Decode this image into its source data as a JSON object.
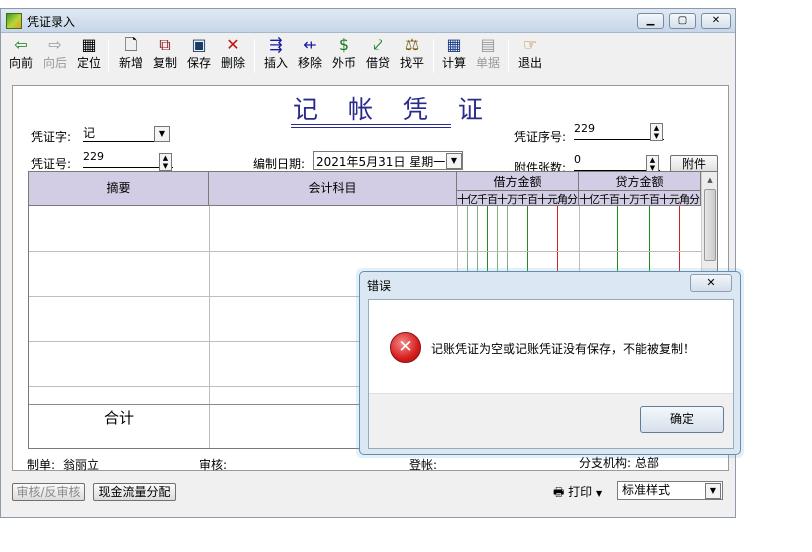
{
  "window": {
    "title": "凭证录入"
  },
  "toolbar": {
    "items": [
      {
        "label": "向前",
        "icon": "back-arrow-icon",
        "enabled": true
      },
      {
        "label": "向后",
        "icon": "forward-arrow-icon",
        "enabled": false
      },
      {
        "label": "定位",
        "icon": "locate-icon",
        "enabled": true
      },
      {
        "label": "新增",
        "icon": "new-document-icon",
        "enabled": true
      },
      {
        "label": "复制",
        "icon": "copy-icon",
        "enabled": true
      },
      {
        "label": "保存",
        "icon": "save-icon",
        "enabled": true
      },
      {
        "label": "删除",
        "icon": "delete-icon",
        "enabled": true
      },
      {
        "label": "插入",
        "icon": "insert-row-icon",
        "enabled": true
      },
      {
        "label": "移除",
        "icon": "remove-row-icon",
        "enabled": true
      },
      {
        "label": "外币",
        "icon": "foreign-currency-icon",
        "enabled": true
      },
      {
        "label": "借贷",
        "icon": "debit-credit-icon",
        "enabled": true
      },
      {
        "label": "找平",
        "icon": "balance-icon",
        "enabled": true
      },
      {
        "label": "计算",
        "icon": "calculator-icon",
        "enabled": true
      },
      {
        "label": "单据",
        "icon": "document-list-icon",
        "enabled": false
      },
      {
        "label": "退出",
        "icon": "exit-icon",
        "enabled": true
      }
    ]
  },
  "voucher": {
    "title": "记 帐 凭 证",
    "type_label": "凭证字:",
    "type_value": "记",
    "number_label": "凭证号:",
    "number_value": "229",
    "date_label": "编制日期:",
    "date_value": "2021年5月31日 星期一",
    "seq_label": "凭证序号:",
    "seq_value": "229",
    "attach_label": "附件张数:",
    "attach_value": "0",
    "attach_button": "附件"
  },
  "grid": {
    "col_summary": "摘要",
    "col_account": "会计科目",
    "col_debit": "借方金额",
    "col_credit": "贷方金额",
    "units": "十亿千百十万千百十元角分",
    "total_label": "合计"
  },
  "footer": {
    "maker_label": "制单:",
    "maker_value": "翁丽立",
    "auditor_label": "审核:",
    "poster_label": "登帐:",
    "branch_label": "分支机构:",
    "branch_value": "总部",
    "audit_button": "审核/反审核",
    "cashflow_button": "现金流量分配",
    "print_label": "打印",
    "style_value": "标准样式"
  },
  "dialog": {
    "title": "错误",
    "message": "记账凭证为空或记账凭证没有保存，不能被复制！",
    "ok_button": "确定",
    "close_symbol": "✕"
  }
}
